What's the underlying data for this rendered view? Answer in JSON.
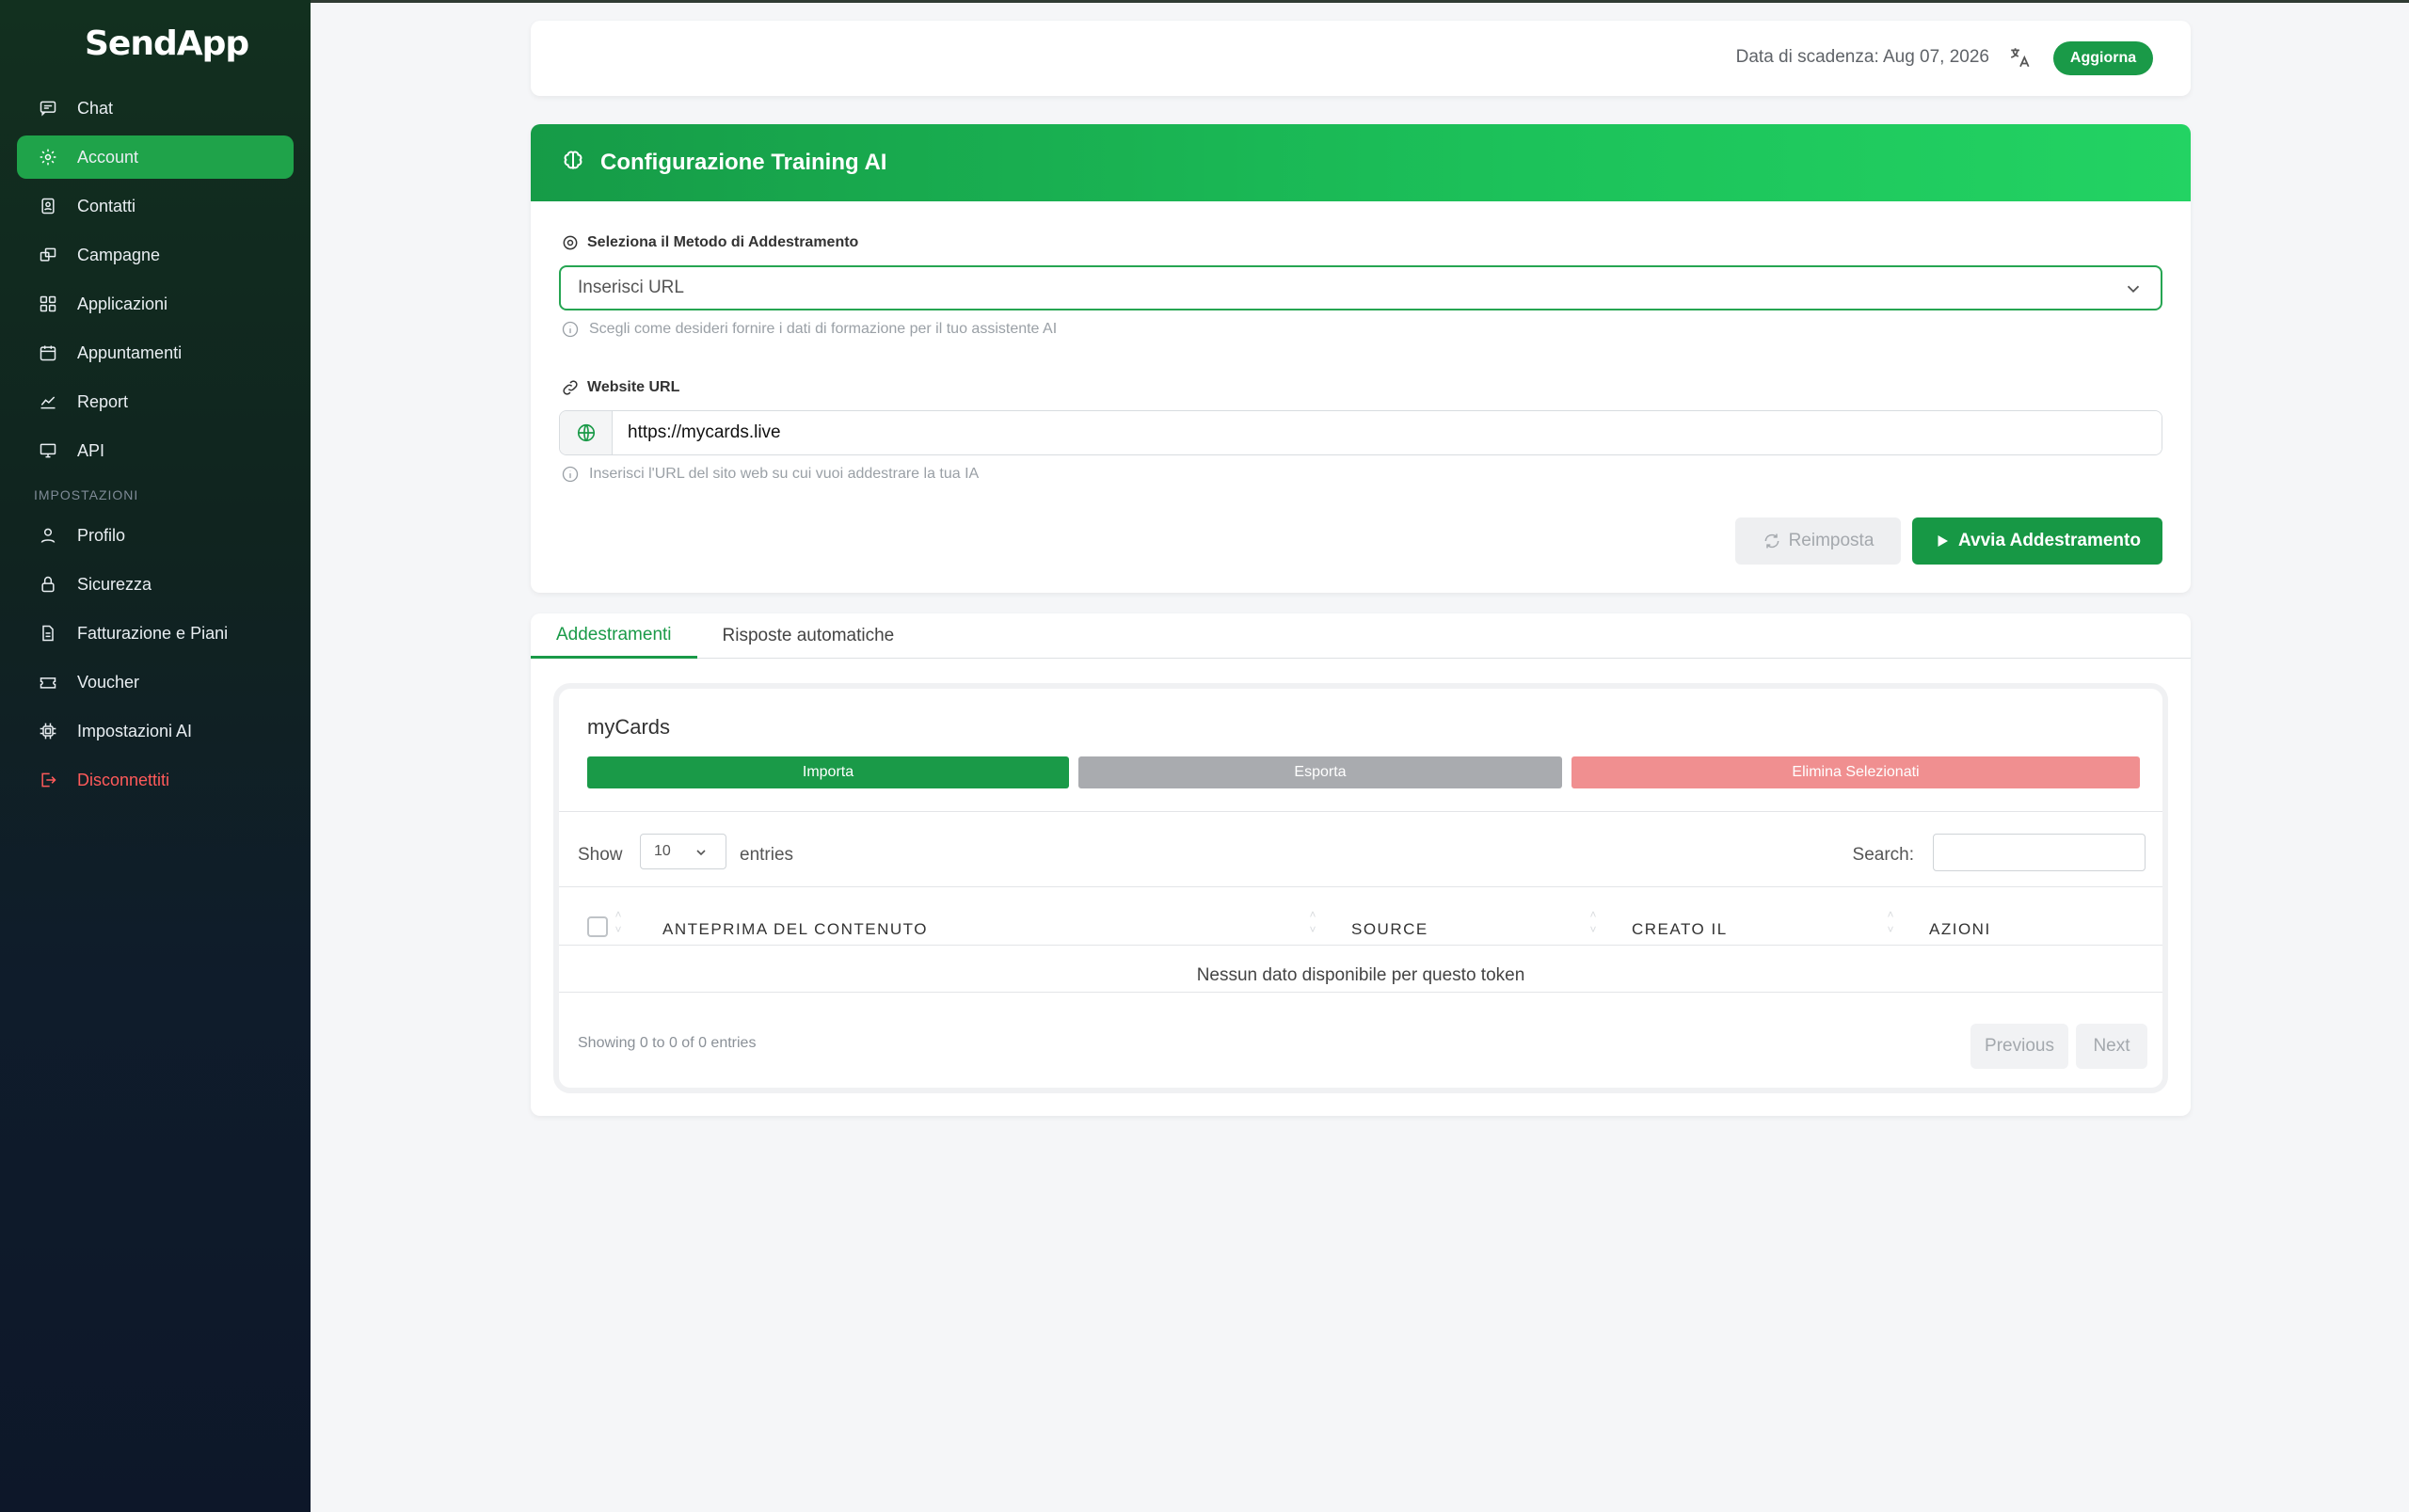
{
  "app": {
    "logo": "SendApp"
  },
  "sidebar": {
    "items": [
      {
        "label": "Chat",
        "icon": "chat-icon"
      },
      {
        "label": "Account",
        "icon": "gear-icon",
        "active": true
      },
      {
        "label": "Contatti",
        "icon": "contacts-icon"
      },
      {
        "label": "Campagne",
        "icon": "campaign-icon"
      },
      {
        "label": "Applicazioni",
        "icon": "apps-icon"
      },
      {
        "label": "Appuntamenti",
        "icon": "calendar-icon"
      },
      {
        "label": "Report",
        "icon": "chart-icon"
      },
      {
        "label": "API",
        "icon": "monitor-icon"
      }
    ],
    "section_label": "IMPOSTAZIONI",
    "settings_items": [
      {
        "label": "Profilo",
        "icon": "user-icon"
      },
      {
        "label": "Sicurezza",
        "icon": "lock-icon"
      },
      {
        "label": "Fatturazione e Piani",
        "icon": "document-icon"
      },
      {
        "label": "Voucher",
        "icon": "ticket-icon"
      },
      {
        "label": "Impostazioni AI",
        "icon": "chip-icon"
      }
    ],
    "logout_label": "Disconnettiti"
  },
  "header": {
    "expiry_text": "Data di scadenza: Aug 07, 2026",
    "update_label": "Aggiorna"
  },
  "training": {
    "title": "Configurazione Training AI",
    "method_label": "Seleziona il Metodo di Addestramento",
    "method_value": "Inserisci URL",
    "method_hint": "Scegli come desideri fornire i dati di formazione per il tuo assistente AI",
    "url_label": "Website URL",
    "url_value": "https://mycards.live",
    "url_hint": "Inserisci l'URL del sito web su cui vuoi addestrare la tua IA",
    "reset_label": "Reimposta",
    "start_label": "Avvia Addestramento"
  },
  "tabs": [
    {
      "label": "Addestramenti",
      "active": true
    },
    {
      "label": "Risposte automatiche"
    }
  ],
  "knowledge": {
    "title": "myCards",
    "import_label": "Importa",
    "export_label": "Esporta",
    "delete_label": "Elimina Selezionati",
    "show_label": "Show",
    "page_length": "10",
    "entries_label": "entries",
    "search_label": "Search:",
    "columns": [
      "ANTEPRIMA DEL CONTENUTO",
      "SOURCE",
      "CREATO IL",
      "AZIONI"
    ],
    "empty_text": "Nessun dato disponibile per questo token",
    "info_text": "Showing 0 to 0 of 0 entries",
    "prev_label": "Previous",
    "next_label": "Next"
  },
  "colors": {
    "accent": "#1a9a48",
    "danger": "#f08f90",
    "sidebar_bg": "#0f1c2b"
  }
}
